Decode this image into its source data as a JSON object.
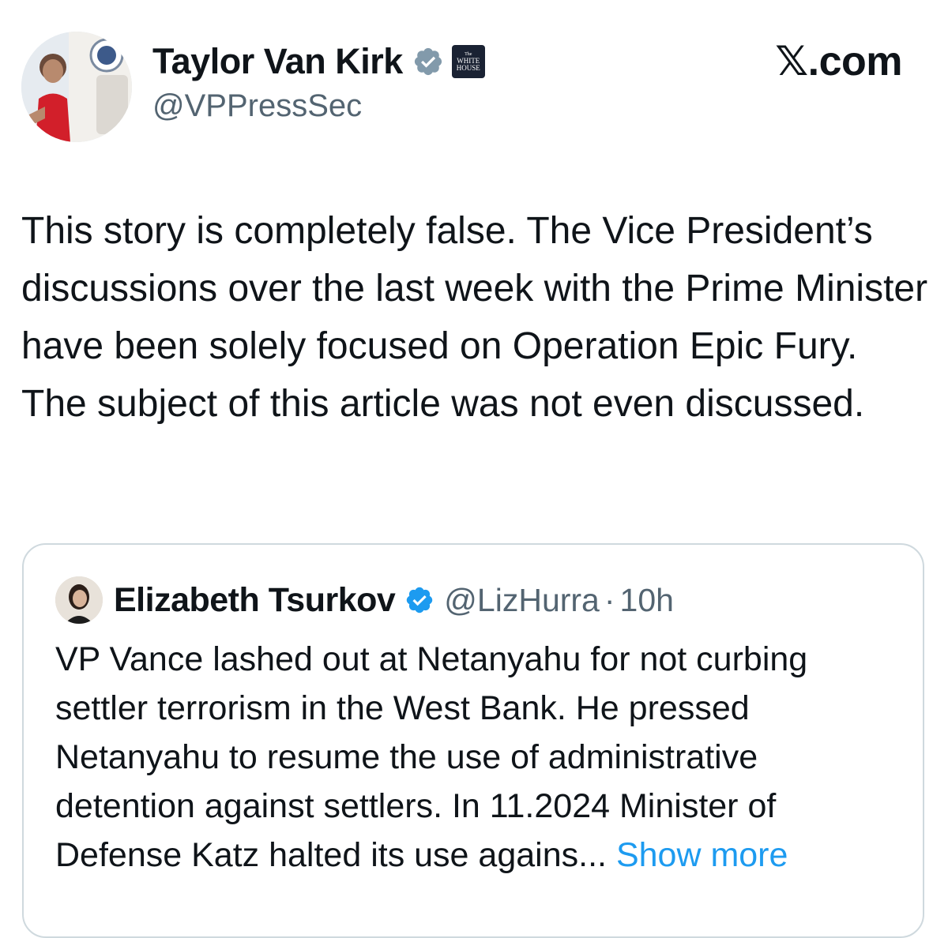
{
  "post": {
    "author": {
      "display_name": "Taylor Van Kirk",
      "handle": "@VPPressSec",
      "verified_icon": "verified-badge-icon",
      "affiliation_badge": {
        "line1": "The",
        "line2": "WHITE",
        "line3": "HOUSE"
      }
    },
    "site_mark": "𝕏.com",
    "text": "This story is completely false. The Vice President’s discussions over the last week with the Prime Minister have been solely focused on Operation Epic Fury. The subject of this article was not even discussed."
  },
  "quote": {
    "author": {
      "display_name": "Elizabeth Tsurkov",
      "handle": "@LizHurra",
      "separator": "·",
      "time": "10h",
      "verified_icon": "verified-badge-icon"
    },
    "text": "VP Vance lashed out at Netanyahu for not curbing settler terrorism in the West Bank. He pressed Netanyahu to resume the use of administrative detention against settlers. In 11.2024 Minister of Defense Katz halted its use agains...",
    "show_more_label": "Show more"
  },
  "colors": {
    "text_primary": "#0f1419",
    "text_secondary": "#536471",
    "link": "#1d9bf0",
    "verified_badge": "#829aab",
    "quote_verified_badge": "#1d9bf0",
    "border": "#cfd9de"
  }
}
